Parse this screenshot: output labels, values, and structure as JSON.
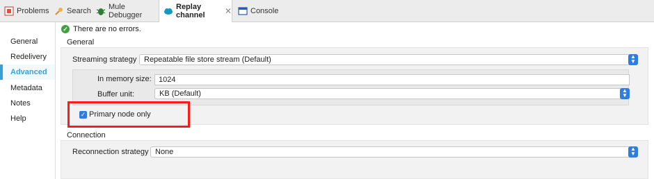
{
  "tabs": [
    {
      "label": "Problems",
      "icon": "problems-icon"
    },
    {
      "label": "Search",
      "icon": "search-icon"
    },
    {
      "label": "Mule Debugger",
      "icon": "debugger-icon"
    },
    {
      "label": "Replay channel",
      "icon": "salesforce-cloud-icon",
      "close": "✕"
    },
    {
      "label": "Console",
      "icon": "console-icon"
    }
  ],
  "nav": {
    "items": [
      "General",
      "Redelivery",
      "Advanced",
      "Metadata",
      "Notes",
      "Help"
    ],
    "active": "Advanced"
  },
  "status": {
    "text": "There are no errors.",
    "icon": "check-circle-icon"
  },
  "general": {
    "title": "General",
    "streaming_label": "Streaming strategy",
    "streaming_value": "Repeatable file store stream (Default)",
    "memory_label": "In memory size:",
    "memory_value": "1024",
    "buffer_label": "Buffer unit:",
    "buffer_value": "KB (Default)",
    "primary_label": "Primary node only",
    "primary_checked": true
  },
  "connection": {
    "title": "Connection",
    "reconnection_label": "Reconnection strategy",
    "reconnection_value": "None"
  },
  "colors": {
    "accent": "#3aa0d8",
    "select_arrow": "#2f7de1",
    "highlight": "#ff1a1a",
    "ok": "#3fa13f"
  }
}
